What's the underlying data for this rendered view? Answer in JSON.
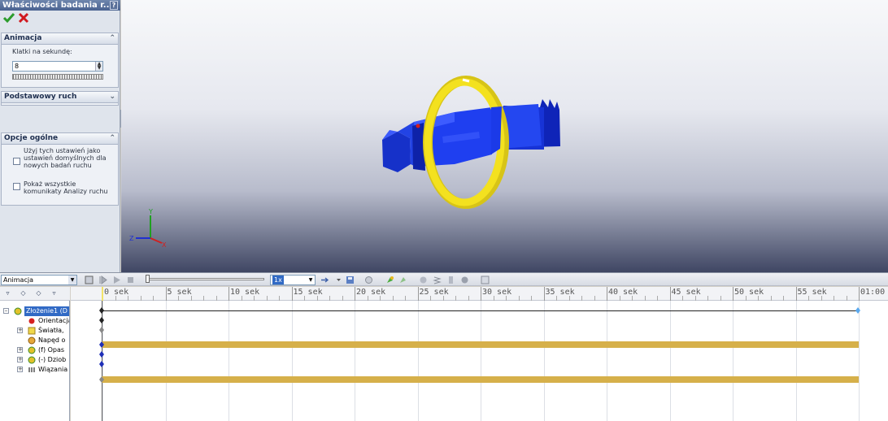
{
  "property_manager": {
    "title": "Właściwości badania r...",
    "help": "?",
    "animation": {
      "header": "Animacja",
      "fps_label": "Klatki na sekundę:",
      "fps_value": "8"
    },
    "basic_motion": {
      "header": "Podstawowy ruch"
    },
    "general": {
      "header": "Opcje ogólne",
      "option1": "Użyj tych ustawień jako ustawień domyślnych dla nowych badań ruchu",
      "option2": "Pokaż wszystkie komunikaty Analizy ruchu"
    }
  },
  "viewport": {
    "triad": {
      "x": "X",
      "y": "Y",
      "z": "Z"
    },
    "colors": {
      "part": "#1c37e0",
      "ring": "#f3e11f"
    }
  },
  "motion_manager": {
    "study_type": "Animacja",
    "speed": "1x",
    "timeline": {
      "labels": [
        "0 sek",
        "5 sek",
        "10 sek",
        "15 sek",
        "20 sek",
        "25 sek",
        "30 sek",
        "35 sek",
        "40 sek",
        "45 sek",
        "50 sek",
        "55 sek",
        "01:00"
      ],
      "bar_color": "#d6b04a"
    },
    "tree": [
      {
        "label": "Złożenie1  (D",
        "icon": "assembly-icon"
      },
      {
        "label": "Orientacja",
        "icon": "orientation-icon"
      },
      {
        "label": "Światła,",
        "icon": "lights-icon"
      },
      {
        "label": "Napęd o",
        "icon": "motor-icon"
      },
      {
        "label": "(f) Opas",
        "icon": "part-icon"
      },
      {
        "label": "(-) Dziob",
        "icon": "part-icon"
      },
      {
        "label": "Wiązania",
        "icon": "mates-icon"
      }
    ]
  }
}
